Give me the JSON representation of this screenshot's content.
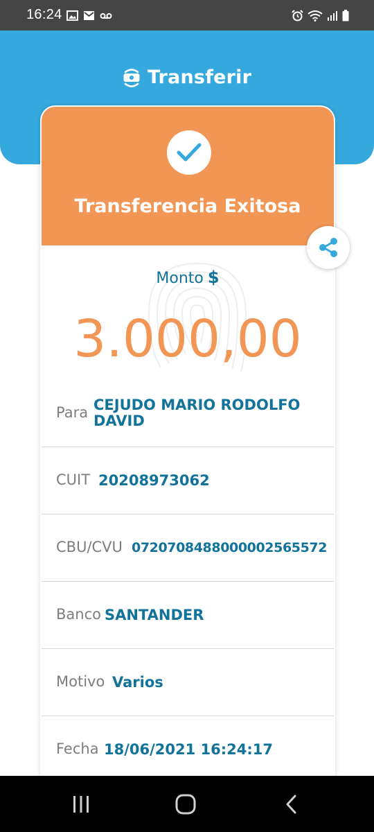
{
  "status_bar": {
    "time": "16:24",
    "left_icons": [
      "image-icon",
      "mail-icon",
      "voicemail-icon"
    ],
    "right_icons": [
      "alarm-icon",
      "wifi-icon",
      "signal-icon",
      "battery-icon"
    ]
  },
  "header": {
    "title": "Transferir",
    "icon": "transfer-icon"
  },
  "result": {
    "title": "Transferencia Exitosa",
    "icon": "check-icon"
  },
  "amount": {
    "label": "Monto",
    "currency": "$",
    "value": "3.000,00"
  },
  "details": [
    {
      "label": "Para",
      "value_line1": "CEJUDO MARIO RODOLFO",
      "value_line2": "DAVID"
    },
    {
      "label": "CUIT",
      "value": "20208973062"
    },
    {
      "label": "CBU/CVU",
      "value": "0720708488000002565572"
    },
    {
      "label": "Banco",
      "value": "SANTANDER"
    },
    {
      "label": "Motivo",
      "value": "Varios"
    },
    {
      "label": "Fecha",
      "value": "18/06/2021 16:24:17"
    }
  ],
  "colors": {
    "header": "#35a9de",
    "success": "#f29655",
    "value_text": "#12739a",
    "label_text": "#7d7d7d"
  },
  "nav": [
    "recents-icon",
    "home-icon",
    "back-icon"
  ]
}
